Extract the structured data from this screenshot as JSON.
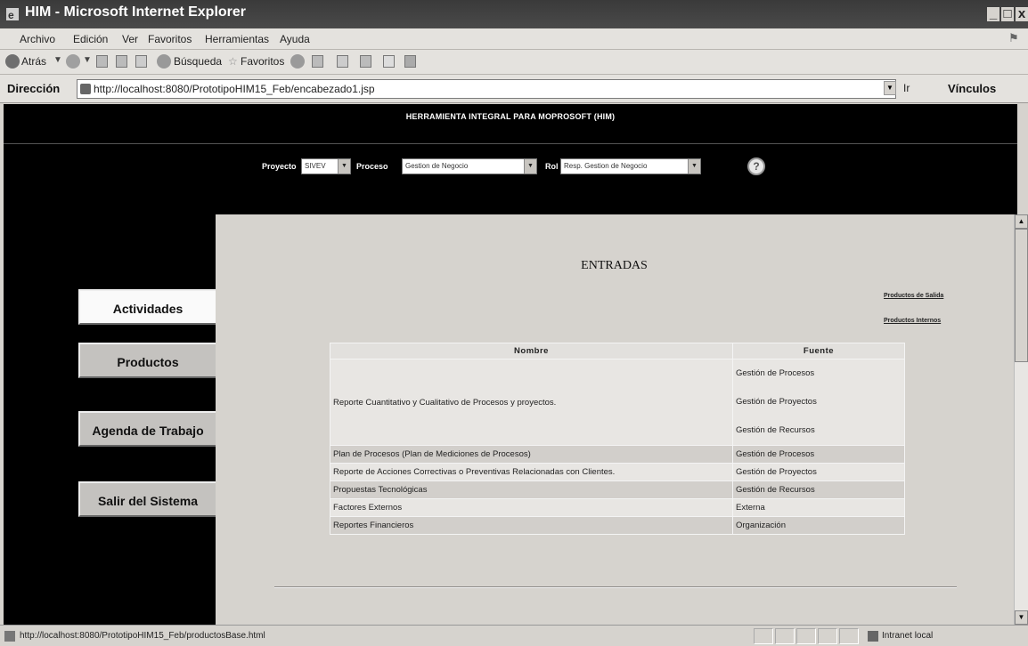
{
  "window": {
    "title": "HIM - Microsoft Internet Explorer",
    "controls": {
      "minimize": "_",
      "maximize": "□",
      "close": "x"
    }
  },
  "menu": [
    "Archivo",
    "Edición",
    "Ver",
    "Favoritos",
    "Herramientas",
    "Ayuda"
  ],
  "toolbar": {
    "back_label": "Atrás",
    "search_label": "Búsqueda",
    "favorites_label": "Favoritos"
  },
  "address": {
    "label": "Dirección",
    "url": "http://localhost:8080/PrototipoHIM15_Feb/encabezado1.jsp",
    "go_label": "Ir",
    "links_label": "Vínculos"
  },
  "page": {
    "header_title": "HERRAMIENTA INTEGRAL PARA MOPROSOFT (HIM)",
    "selectors": {
      "proyecto_label": "Proyecto",
      "proyecto_value": "SIVEV",
      "proceso_label": "Proceso",
      "proceso_value": "Gestion de Negocio",
      "rol_label": "Rol",
      "rol_value": "Resp. Gestion de Negocio"
    },
    "nav": [
      {
        "label": "Actividades",
        "active": true
      },
      {
        "label": "Productos",
        "active": false
      },
      {
        "label": "Agenda de Trabajo",
        "active": false
      },
      {
        "label": "Salir del Sistema",
        "active": false
      }
    ],
    "main": {
      "title": "ENTRADAS",
      "links": [
        "Productos de Salida",
        "Productos Internos"
      ],
      "table": {
        "headers": [
          "Nombre",
          "Fuente"
        ],
        "rows": [
          {
            "nombre": "Reporte Cuantitativo y Cualitativo de Procesos y proyectos.",
            "fuentes": [
              "Gestión de Procesos",
              "Gestión de Proyectos",
              "Gestión de Recursos"
            ]
          },
          {
            "nombre": "Plan de Procesos (Plan de Mediciones de Procesos)",
            "fuentes": [
              "Gestión de Procesos"
            ]
          },
          {
            "nombre": "Reporte de Acciones Correctivas o Preventivas Relacionadas con Clientes.",
            "fuentes": [
              "Gestión de Proyectos"
            ]
          },
          {
            "nombre": "Propuestas Tecnológicas",
            "fuentes": [
              "Gestión de Recursos"
            ]
          },
          {
            "nombre": "Factores Externos",
            "fuentes": [
              "Externa"
            ]
          },
          {
            "nombre": "Reportes Financieros",
            "fuentes": [
              "Organización"
            ]
          }
        ]
      }
    }
  },
  "status": {
    "text": "http://localhost:8080/PrototipoHIM15_Feb/productosBase.html",
    "zone": "Intranet local"
  },
  "colors": {
    "page_bg": "#000000",
    "panel_bg": "#d6d3ce"
  },
  "icons": [
    "ie-icon",
    "back-icon",
    "forward-icon",
    "stop-icon",
    "refresh-icon",
    "home-icon",
    "search-icon",
    "favorites-icon",
    "history-icon",
    "mail-icon",
    "print-icon",
    "help-icon",
    "page-icon",
    "intranet-icon",
    "windows-flag-icon"
  ]
}
